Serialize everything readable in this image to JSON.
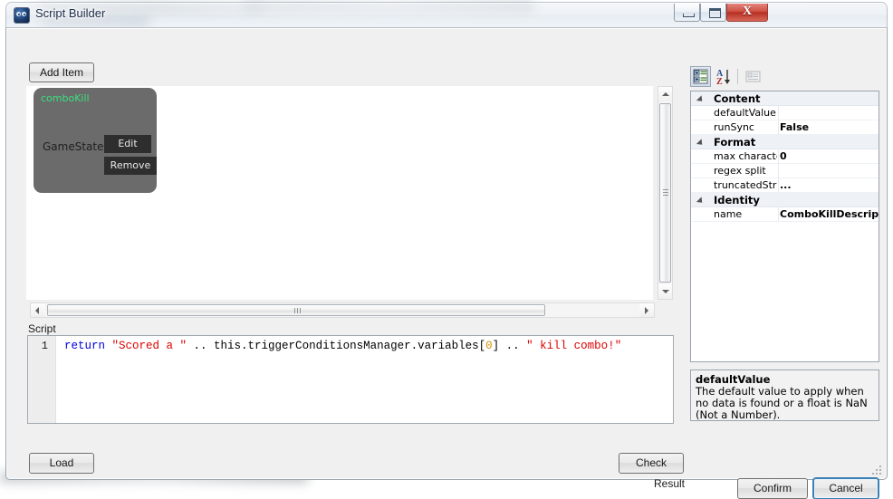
{
  "window": {
    "title": "Script Builder",
    "icon": "app-icon",
    "caption_buttons": {
      "minimize": "minimize-icon",
      "maximize": "restore-icon",
      "close": "X"
    }
  },
  "toolbar": {
    "add_item_label": "Add Item"
  },
  "canvas": {
    "items": [
      {
        "title": "comboKill",
        "title_color": "#3ae07e",
        "type_label": "GameState",
        "edit_label": "Edit",
        "remove_label": "Remove"
      }
    ]
  },
  "script": {
    "label": "Script",
    "line_number": "1",
    "code_tokens": [
      {
        "text": "return ",
        "kind": "kw"
      },
      {
        "text": "\"Scored a \"",
        "kind": "str"
      },
      {
        "text": " .. ",
        "kind": "pun"
      },
      {
        "text": "this.triggerConditionsManager.variables",
        "kind": "pun"
      },
      {
        "text": "[",
        "kind": "pun"
      },
      {
        "text": "0",
        "kind": "num"
      },
      {
        "text": "]",
        "kind": "pun"
      },
      {
        "text": " .. ",
        "kind": "pun"
      },
      {
        "text": "\" kill combo!\"",
        "kind": "str"
      }
    ],
    "code_plain": "return \"Scored a \" .. this.triggerConditionsManager.variables[0] .. \" kill combo!\""
  },
  "property_grid": {
    "toolbar": {
      "categorized": "categorized-view-icon",
      "alphabetical": "alphabetical-sort-icon",
      "property_pages": "property-pages-icon"
    },
    "rows": [
      {
        "kind": "category",
        "name": "Content"
      },
      {
        "kind": "property",
        "name": "defaultValue",
        "value": ""
      },
      {
        "kind": "property",
        "name": "runSync",
        "value": "False"
      },
      {
        "kind": "category",
        "name": "Format"
      },
      {
        "kind": "property",
        "name": "max characters",
        "value": "0"
      },
      {
        "kind": "property",
        "name": "regex split",
        "value": ""
      },
      {
        "kind": "property",
        "name": "truncatedString",
        "value": "..."
      },
      {
        "kind": "category",
        "name": "Identity"
      },
      {
        "kind": "property",
        "name": "name",
        "value": "ComboKillDescriptio"
      }
    ],
    "description": {
      "title": "defaultValue",
      "body": "The default value to apply when no data is found or a float is NaN (Not a Number)."
    }
  },
  "footer": {
    "load_label": "Load",
    "check_label": "Check",
    "result_label": "Result",
    "confirm_label": "Confirm",
    "cancel_label": "Cancel"
  }
}
